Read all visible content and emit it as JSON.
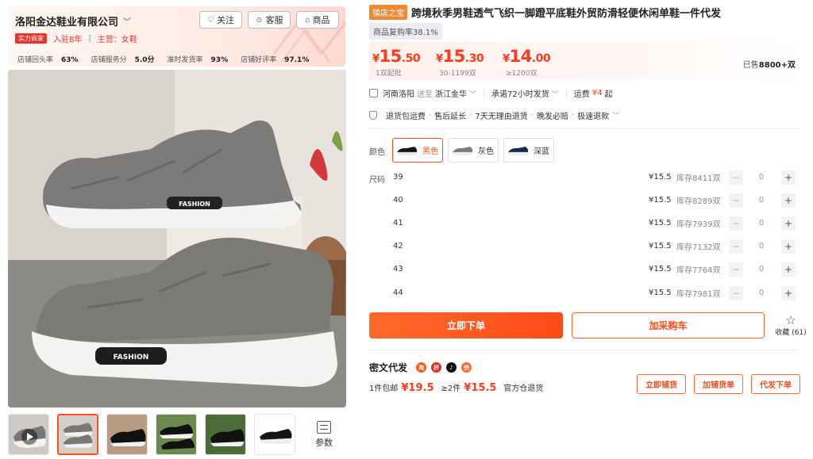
{
  "shop": {
    "name": "洛阳金达鞋业有限公司",
    "follow_label": "关注",
    "service_label": "客服",
    "shop_label": "商品",
    "strength_badge": "实力商家",
    "years": "入驻8年",
    "main_business": "主营：女鞋",
    "stats": [
      {
        "label": "店铺回头率",
        "value": "63%"
      },
      {
        "label": "店铺服务分",
        "value": "5.0分"
      },
      {
        "label": "准时发货率",
        "value": "93%"
      },
      {
        "label": "店铺好评率",
        "value": "97.1%"
      }
    ]
  },
  "gallery": {
    "param_label": "参数"
  },
  "product": {
    "store_badge": "镇店之宝",
    "title": "跨境秋季男鞋透气飞织一脚蹬平底鞋外贸防滑轻便休闲单鞋一件代发",
    "repurchase": "商品复购率38.1%",
    "prices": [
      {
        "yen": "¥",
        "int": "15",
        "dec": ".50",
        "range": "1双起批"
      },
      {
        "yen": "¥",
        "int": "15",
        "dec": ".30",
        "range": "30-1199双"
      },
      {
        "yen": "¥",
        "int": "14",
        "dec": ".00",
        "range": "≥1200双"
      }
    ],
    "sold_prefix": "已售",
    "sold_value": "8800+双"
  },
  "shipping": {
    "from": "河南洛阳",
    "to_word": "送至",
    "to": "浙江金华",
    "promise": "承诺72小时发货",
    "fee_label": "运费",
    "fee_value": "¥4",
    "fee_suffix": "起"
  },
  "services": [
    "退货包运费",
    "售后延长",
    "7天无理由退货",
    "晚发必赔",
    "极速退款"
  ],
  "colors": {
    "label": "颜色",
    "options": [
      {
        "name": "黑色",
        "selected": true
      },
      {
        "name": "灰色",
        "selected": false
      },
      {
        "name": "深蓝",
        "selected": false
      }
    ]
  },
  "sizes": {
    "label": "尺码",
    "rows": [
      {
        "size": "39",
        "price": "¥15.5",
        "stock": "库存8411双",
        "qty": "0"
      },
      {
        "size": "40",
        "price": "¥15.5",
        "stock": "库存8289双",
        "qty": "0"
      },
      {
        "size": "41",
        "price": "¥15.5",
        "stock": "库存7939双",
        "qty": "0"
      },
      {
        "size": "42",
        "price": "¥15.5",
        "stock": "库存7132双",
        "qty": "0"
      },
      {
        "size": "43",
        "price": "¥15.5",
        "stock": "库存7764双",
        "qty": "0"
      },
      {
        "size": "44",
        "price": "¥15.5",
        "stock": "库存7981双",
        "qty": "0"
      }
    ],
    "minus": "−",
    "plus": "+"
  },
  "actions": {
    "buy_now": "立即下单",
    "add_cart": "加采购车",
    "favorite": "收藏 (61)"
  },
  "dropship": {
    "title": "密文代发",
    "one_piece": "1件包邮",
    "one_piece_price": "¥19.5",
    "two_piece": "≥2件",
    "two_piece_price": "¥15.5",
    "return": "官方仓退货",
    "btn_listing": "立即铺货",
    "btn_add_listing": "加铺货单",
    "btn_dropship": "代发下单"
  },
  "theme": {
    "accent": "#ff4a1a",
    "price_red": "#ff3b1f",
    "badge_orange": "#ee8a33"
  }
}
